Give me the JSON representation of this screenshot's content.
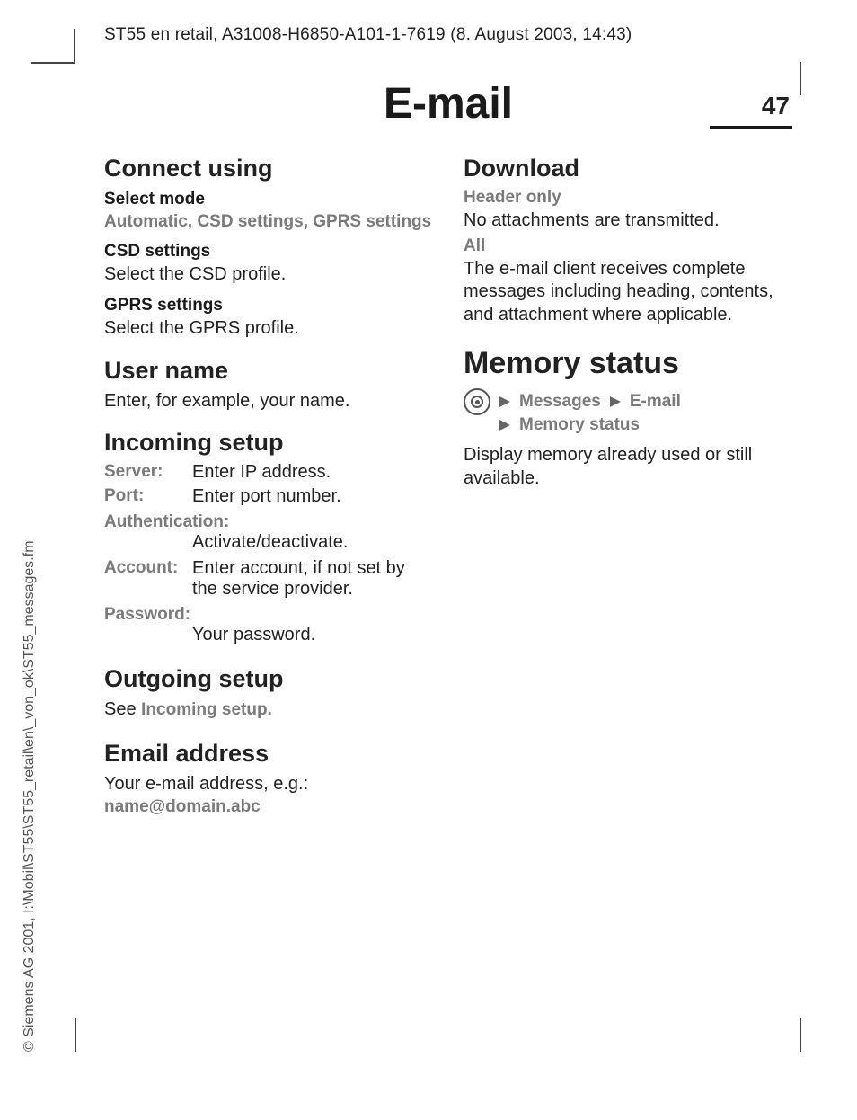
{
  "header_line": "ST55 en retail, A31008-H6850-A101-1-7619 (8. August 2003, 14:43)",
  "side_text": "© Siemens AG 2001, I:\\Mobil\\ST55\\ST55_retail\\en\\_von_ok\\ST55_messages.fm",
  "page_title": "E-mail",
  "page_number": "47",
  "left": {
    "connect_using": "Connect using",
    "select_mode": "Select mode",
    "select_mode_opts": "Automatic, CSD settings, GPRS settings",
    "csd_settings": "CSD settings",
    "csd_body": "Select the CSD profile.",
    "gprs_settings": "GPRS settings",
    "gprs_body": "Select the GPRS profile.",
    "user_name": "User name",
    "user_name_body": "Enter, for example, your name.",
    "incoming_setup": "Incoming setup",
    "rows": {
      "server_lbl": "Server:",
      "server_val": "Enter IP address.",
      "port_lbl": "Port:",
      "port_val": "Enter port number.",
      "auth_lbl": "Authentication:",
      "auth_val": "Activate/deactivate.",
      "account_lbl": "Account:",
      "account_val": "Enter account, if not set by the service provider.",
      "password_lbl": "Password:",
      "password_val": "Your password."
    },
    "outgoing_setup": "Outgoing setup",
    "outgoing_body_prefix": "See ",
    "outgoing_body_link": "Incoming setup.",
    "email_address": "Email address",
    "email_body": "Your e-mail address, e.g.:",
    "email_example": "name@domain.abc"
  },
  "right": {
    "download": "Download",
    "header_only": "Header only",
    "header_only_body": "No attachments are transmitted.",
    "all": "All",
    "all_body": "The e-mail client receives complete messages including heading, contents, and attachment where applicable.",
    "memory_status": "Memory status",
    "nav_messages": "Messages",
    "nav_email": "E-mail",
    "nav_memory": "Memory status",
    "memory_body": "Display memory already used or still available."
  }
}
